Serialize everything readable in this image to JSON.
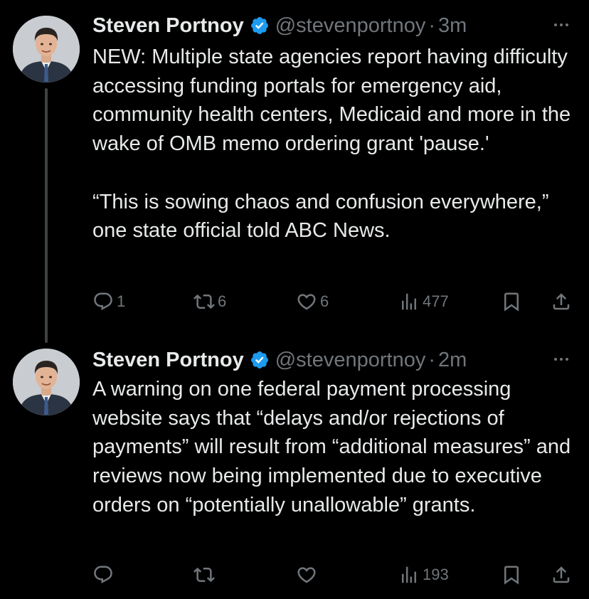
{
  "colors": {
    "background": "#000000",
    "text_primary": "#e7e9ea",
    "text_secondary": "#71767b",
    "verified_badge": "#1d9bf0",
    "thread_line": "#3e4144"
  },
  "tweets": [
    {
      "author": {
        "display_name": "Steven Portnoy",
        "handle": "@stevenportnoy",
        "verified_icon": "verified-badge-icon",
        "avatar_icon": "avatar-photo"
      },
      "separator": "·",
      "time": "3m",
      "more_icon": "more-options-icon",
      "text": [
        "NEW: Multiple state agencies report having difficulty accessing funding portals for emergency aid, community health centers, Medicaid and more in the wake of OMB memo ordering grant 'pause.'",
        "“This is sowing chaos and confusion everywhere,” one state official told ABC News."
      ],
      "metrics": {
        "replies": "1",
        "reposts": "6",
        "likes": "6",
        "views": "477"
      }
    },
    {
      "author": {
        "display_name": "Steven Portnoy",
        "handle": "@stevenportnoy",
        "verified_icon": "verified-badge-icon",
        "avatar_icon": "avatar-photo"
      },
      "separator": "·",
      "time": "2m",
      "more_icon": "more-options-icon",
      "text": [
        "A warning on one federal payment processing website says that “delays and/or rejections of payments” will result from “additional measures” and reviews now being implemented due to executive orders on “potentially unallowable” grants."
      ],
      "metrics": {
        "replies": "",
        "reposts": "",
        "likes": "",
        "views": "193"
      }
    }
  ]
}
